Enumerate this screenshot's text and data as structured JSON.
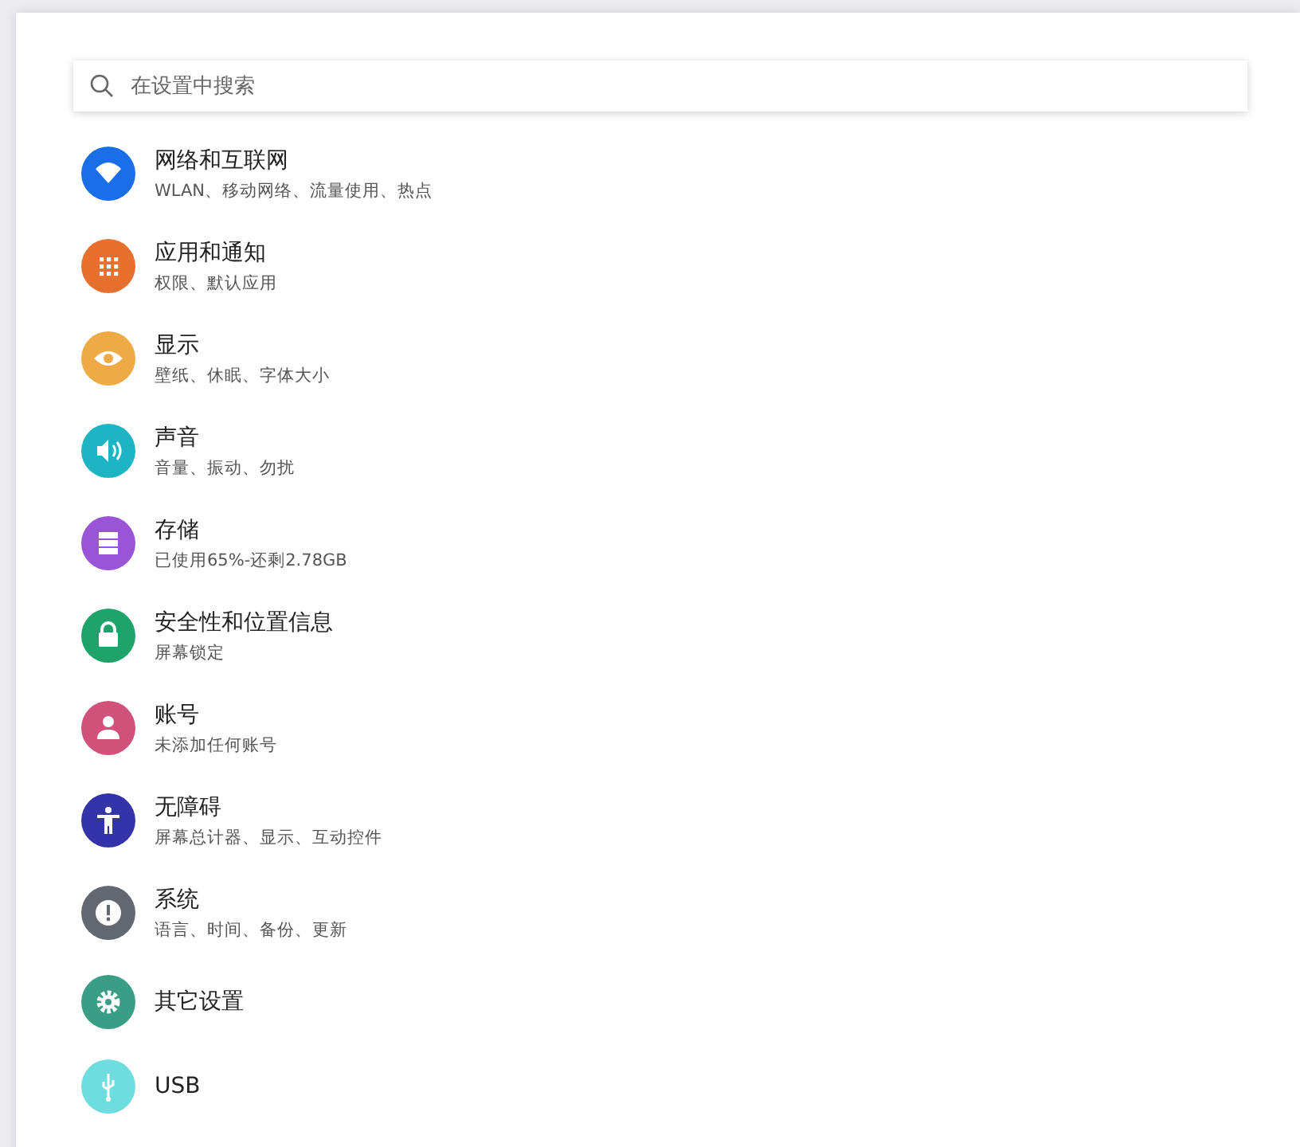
{
  "search": {
    "placeholder": "在设置中搜索"
  },
  "items": [
    {
      "kind": "wifi",
      "color": "#1a6ee8",
      "title": "网络和互联网",
      "subtitle": "WLAN、移动网络、流量使用、热点"
    },
    {
      "kind": "apps",
      "color": "#e8702e",
      "title": "应用和通知",
      "subtitle": "权限、默认应用"
    },
    {
      "kind": "eye",
      "color": "#eeaa44",
      "title": "显示",
      "subtitle": "壁纸、休眠、字体大小"
    },
    {
      "kind": "speaker",
      "color": "#1db5c4",
      "title": "声音",
      "subtitle": "音量、振动、勿扰"
    },
    {
      "kind": "storage",
      "color": "#9a55d6",
      "title": "存储",
      "subtitle": "已使用65%-还剩2.78GB"
    },
    {
      "kind": "lock",
      "color": "#1fa36a",
      "title": "安全性和位置信息",
      "subtitle": "屏幕锁定"
    },
    {
      "kind": "person",
      "color": "#d0527a",
      "title": "账号",
      "subtitle": "未添加任何账号"
    },
    {
      "kind": "accessibility",
      "color": "#3434a8",
      "title": "无障碍",
      "subtitle": "屏幕总计器、显示、互动控件"
    },
    {
      "kind": "alert",
      "color": "#636770",
      "title": "系统",
      "subtitle": "语言、时间、备份、更新"
    },
    {
      "kind": "gear",
      "color": "#3a9e85",
      "title": "其它设置"
    },
    {
      "kind": "usb",
      "color": "#6fdcdf",
      "title": "USB"
    }
  ]
}
